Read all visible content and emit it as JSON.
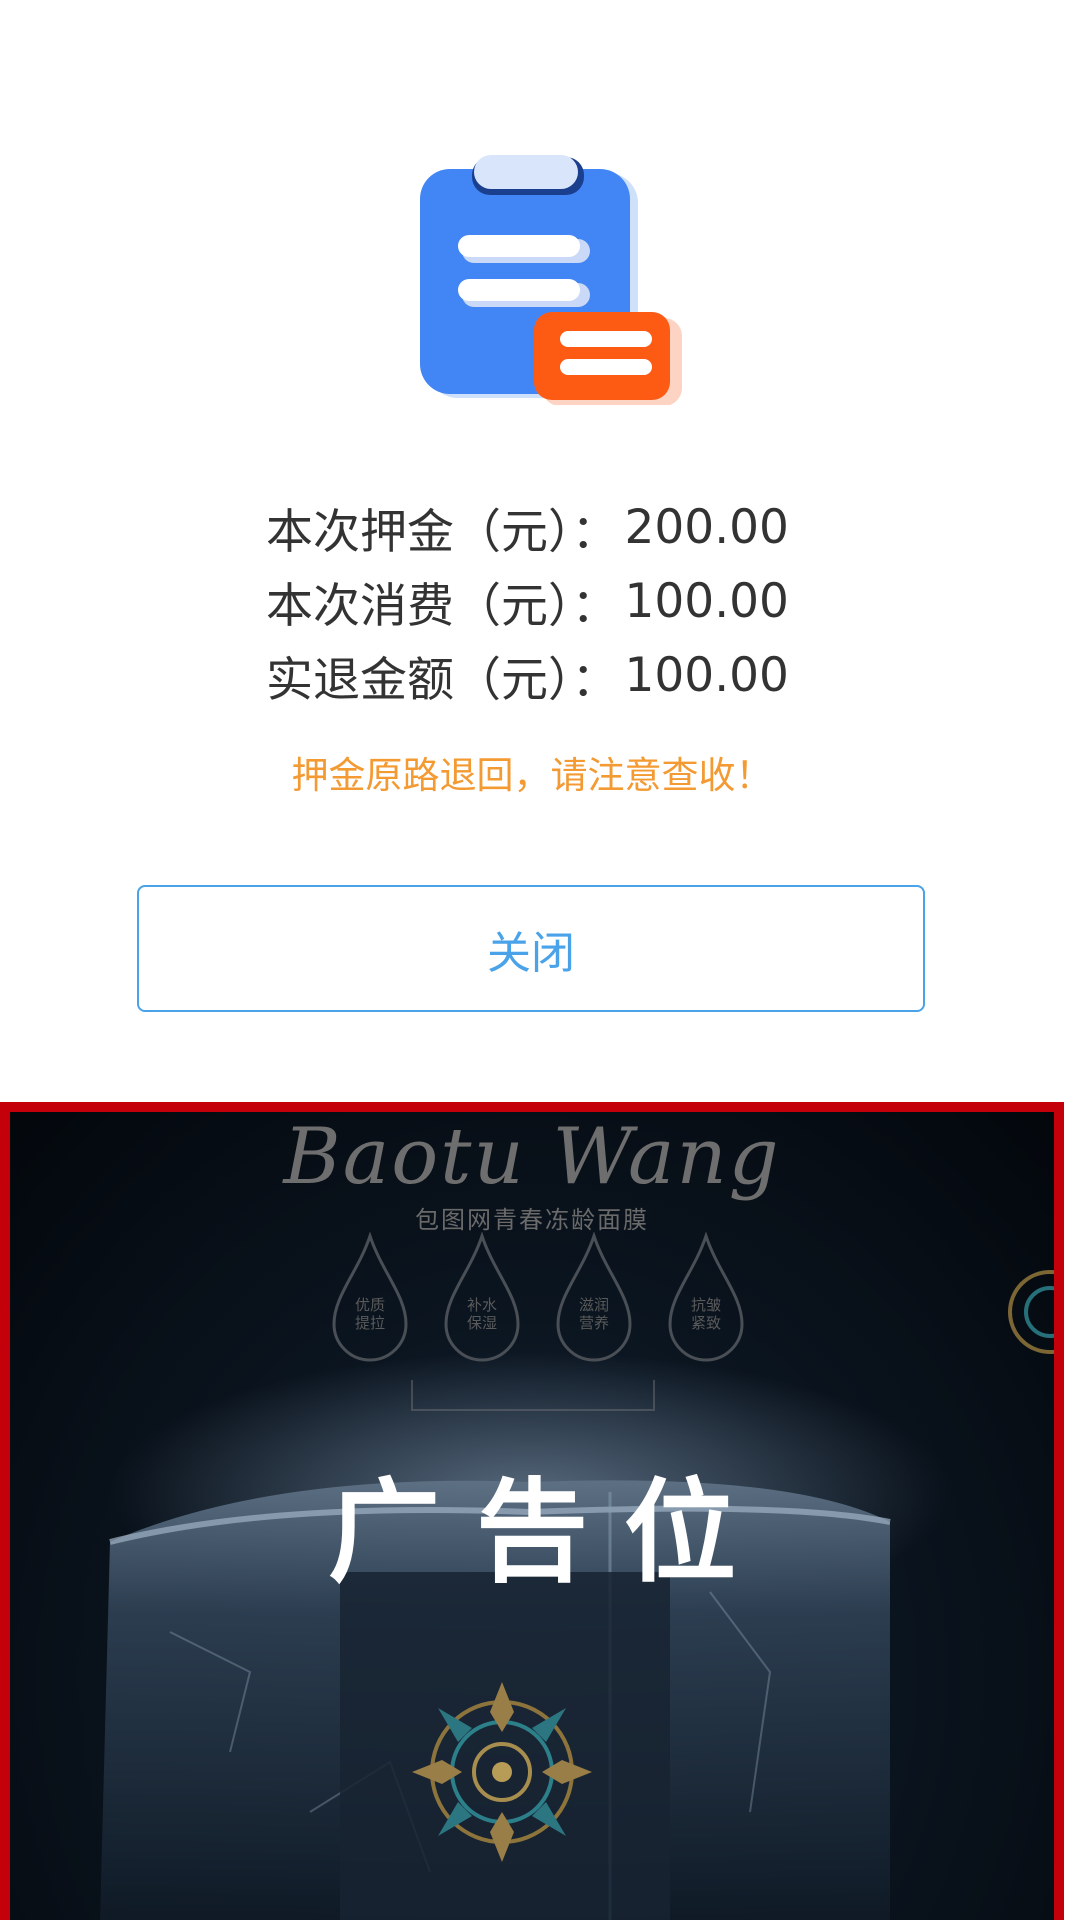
{
  "amounts": [
    {
      "label": "本次押金（元）：",
      "value": "200.00"
    },
    {
      "label": "本次消费（元）：",
      "value": "100.00"
    },
    {
      "label": "实退金额（元）：",
      "value": "100.00"
    }
  ],
  "notice": "押金原路退回，请注意查收！",
  "close_button": {
    "label": "关闭"
  },
  "ad": {
    "brand": "Baotu Wang",
    "subtitle": "包图网青春冻龄面膜",
    "drops": [
      "优质\n提拉",
      "补水\n保湿",
      "滋润\n营养",
      "抗皱\n紧致"
    ],
    "caption": "广告位"
  },
  "colors": {
    "icon_blue": "#4285f4",
    "icon_orange": "#fd5b14",
    "notice": "#f39a33",
    "button_border": "#4aa3e8",
    "ad_border": "#c4000b"
  }
}
